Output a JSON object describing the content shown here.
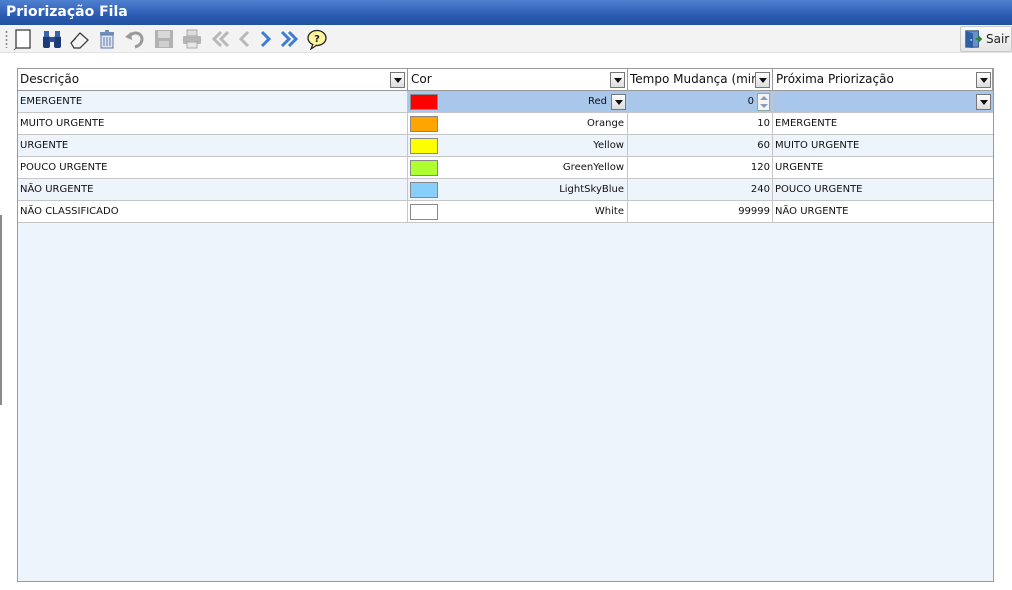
{
  "window": {
    "title": "Priorização Fila"
  },
  "toolbar": {
    "buttons": [
      {
        "icon": "new-document-icon"
      },
      {
        "icon": "binoculars-icon"
      },
      {
        "icon": "eraser-icon"
      },
      {
        "icon": "trash-icon"
      },
      {
        "icon": "undo-icon"
      },
      {
        "icon": "save-icon"
      },
      {
        "icon": "print-icon"
      },
      {
        "icon": "first-record-icon"
      },
      {
        "icon": "previous-record-icon"
      },
      {
        "icon": "next-record-icon"
      },
      {
        "icon": "last-record-icon"
      },
      {
        "icon": "help-icon"
      }
    ],
    "exit_label": "Sair"
  },
  "grid": {
    "columns": [
      "Descrição",
      "Cor",
      "Tempo Mudança (minu",
      "Próxima Priorização"
    ],
    "rows": [
      {
        "descricao": "EMERGENTE",
        "cor": "Red",
        "cor_hex": "#ff0000",
        "tempo": "0",
        "proxima": ""
      },
      {
        "descricao": "MUITO URGENTE",
        "cor": "Orange",
        "cor_hex": "#ffa500",
        "tempo": "10",
        "proxima": "EMERGENTE"
      },
      {
        "descricao": "URGENTE",
        "cor": "Yellow",
        "cor_hex": "#ffff00",
        "tempo": "60",
        "proxima": "MUITO URGENTE"
      },
      {
        "descricao": "POUCO URGENTE",
        "cor": "GreenYellow",
        "cor_hex": "#adff2f",
        "tempo": "120",
        "proxima": "URGENTE"
      },
      {
        "descricao": "NÃO URGENTE",
        "cor": "LightSkyBlue",
        "cor_hex": "#87cefa",
        "tempo": "240",
        "proxima": "POUCO URGENTE"
      },
      {
        "descricao": "NÃO CLASSIFICADO",
        "cor": "White",
        "cor_hex": "#ffffff",
        "tempo": "99999",
        "proxima": "NÃO URGENTE"
      }
    ],
    "selected_row_index": 0
  },
  "colors": {
    "title_bar": "#2b5cb4",
    "grid_background": "#edf4fb",
    "selection": "#a9c6eb"
  }
}
